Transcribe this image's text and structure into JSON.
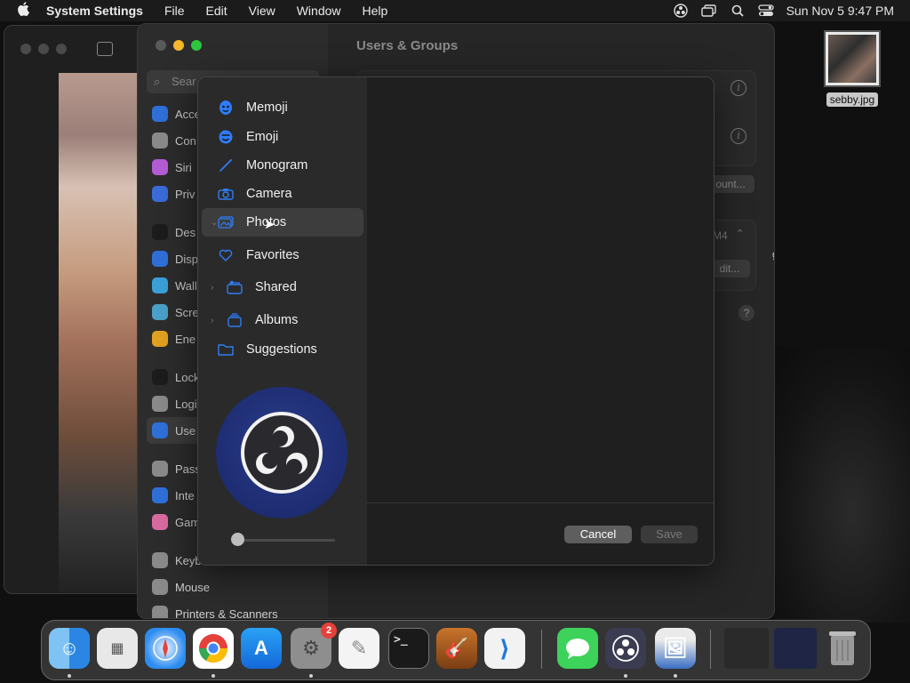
{
  "menubar": {
    "apple_icon": "apple-icon",
    "app_name": "System Settings",
    "menus": [
      "File",
      "Edit",
      "View",
      "Window",
      "Help"
    ],
    "status_icons": [
      "obs-icon",
      "screen-mirror-icon",
      "search-icon",
      "control-center-icon"
    ],
    "datetime": "Sun Nov 5  9:47 PM"
  },
  "settings_window": {
    "title": "Users & Groups",
    "search_placeholder": "Sear",
    "sidebar_items": [
      {
        "label": "Acce",
        "color": "#2f6fd8"
      },
      {
        "label": "Con",
        "color": "#8a8a8a"
      },
      {
        "label": "Siri",
        "color": "#b45cd6"
      },
      {
        "label": "Priv",
        "color": "#3a6bd8"
      },
      {
        "label": "Des",
        "color": "#1c1c1c"
      },
      {
        "label": "Disp",
        "color": "#2f6fd8"
      },
      {
        "label": "Wall",
        "color": "#3aa0d8"
      },
      {
        "label": "Scre",
        "color": "#4aa0c8"
      },
      {
        "label": "Ene",
        "color": "#e0a020"
      },
      {
        "label": "Lock",
        "color": "#1c1c1c"
      },
      {
        "label": "Logi",
        "color": "#8a8a8a"
      },
      {
        "label": "Use",
        "color": "#2f6fd8"
      },
      {
        "label": "Pass",
        "color": "#8a8a8a"
      },
      {
        "label": "Inte",
        "color": "#2f6fd8"
      },
      {
        "label": "Gam",
        "color": "#d86aa0"
      },
      {
        "label": "Keyb",
        "color": "#8a8a8a"
      },
      {
        "label": "Mouse",
        "color": "#8a8a8a"
      },
      {
        "label": "Printers & Scanners",
        "color": "#8a8a8a"
      }
    ],
    "add_account_label": "ount...",
    "edit_label": "dit...",
    "dropdown_fragment": "M4",
    "right_edge_fragment": "g"
  },
  "picture_dialog": {
    "sources": [
      {
        "label": "Memoji",
        "icon": "memoji-icon"
      },
      {
        "label": "Emoji",
        "icon": "emoji-icon"
      },
      {
        "label": "Monogram",
        "icon": "pencil-icon"
      },
      {
        "label": "Camera",
        "icon": "camera-icon"
      },
      {
        "label": "Photos",
        "icon": "photos-icon"
      },
      {
        "label": "Favorites",
        "icon": "heart-icon"
      },
      {
        "label": "Shared",
        "icon": "shared-album-icon"
      },
      {
        "label": "Albums",
        "icon": "albums-icon"
      },
      {
        "label": "Suggestions",
        "icon": "folder-icon"
      }
    ],
    "selected": "Photos",
    "zoom_slider": 0.0,
    "cancel_label": "Cancel",
    "save_label": "Save"
  },
  "desktop_file": {
    "name": "sebby.jpg"
  },
  "dock": {
    "apps": [
      "Finder",
      "Launchpad",
      "Safari",
      "Chrome",
      "App Store",
      "System Settings",
      "TextEdit",
      "Terminal",
      "GarageBand",
      "VS Code",
      "Messages",
      "OBS",
      "Preview"
    ],
    "system_settings_badge": "2",
    "terminal_glyph": ">_"
  }
}
